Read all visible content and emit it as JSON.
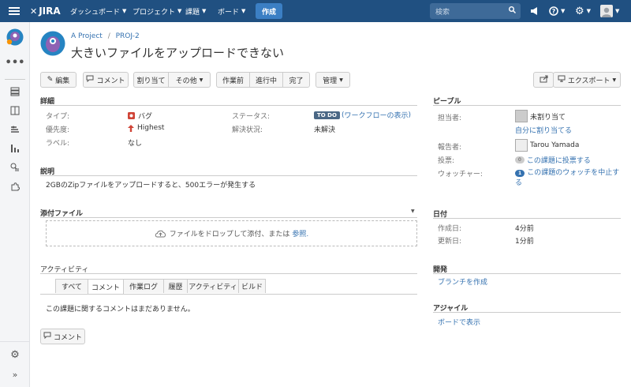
{
  "topnav": {
    "logo": "JIRA",
    "menu": [
      "ダッシュボード",
      "プロジェクト",
      "課題",
      "ボード"
    ],
    "create_label": "作成",
    "search_placeholder": "検索"
  },
  "breadcrumb": {
    "project": "A Project",
    "sep": "/",
    "issue": "PROJ-2"
  },
  "issue_title": "大きいファイルをアップロードできない",
  "toolbar": {
    "edit": "編集",
    "comment": "コメント",
    "assign": "割り当て",
    "more": "その他",
    "workflow": [
      "作業前",
      "進行中",
      "完了"
    ],
    "admin": "管理",
    "export": "エクスポート"
  },
  "details": {
    "heading": "詳細",
    "type_label": "タイプ:",
    "type_value": "バグ",
    "priority_label": "優先度:",
    "priority_value": "Highest",
    "labels_label": "ラベル:",
    "labels_value": "なし",
    "status_label": "ステータス:",
    "status_badge": "TO DO",
    "status_open": "(",
    "status_link": "ワークフローの表示",
    "status_close": ")",
    "resolution_label": "解決状況:",
    "resolution_value": "未解決"
  },
  "description": {
    "heading": "説明",
    "text": "2GBのZipファイルをアップロードすると、500エラーが発生する"
  },
  "attachments": {
    "heading": "添付ファイル",
    "drop_text": "ファイルをドロップして添付、または",
    "browse": "参照."
  },
  "activity": {
    "heading": "アクティビティ",
    "tabs": [
      "すべて",
      "コメント",
      "作業ログ",
      "履歴",
      "アクティビティ",
      "ビルド"
    ],
    "empty": "この課題に関するコメントはまだありません。",
    "comment_button": "コメント"
  },
  "people": {
    "heading": "ピープル",
    "assignee_label": "担当者:",
    "assignee_value": "未割り当て",
    "assign_me": "自分に割り当てる",
    "reporter_label": "報告者:",
    "reporter_value": "Tarou Yamada",
    "votes_label": "投票:",
    "votes_count": "0",
    "votes_link": "この課題に投票する",
    "watchers_label": "ウォッチャー:",
    "watchers_count": "1",
    "watchers_link": "この課題のウォッチを中止する"
  },
  "dates": {
    "heading": "日付",
    "created_label": "作成日:",
    "created_value": "4分前",
    "updated_label": "更新日:",
    "updated_value": "1分前"
  },
  "development": {
    "heading": "開発",
    "link": "ブランチを作成"
  },
  "agile": {
    "heading": "アジャイル",
    "link": "ボードで表示"
  },
  "colors": {
    "nav": "#205081",
    "create": "#3b7fc4",
    "link": "#3572b0",
    "todo": "#4a6785",
    "bug": "#d04437",
    "priority": "#d04437"
  },
  "icons": [
    "menu-icon",
    "jira-logo-icon",
    "search-icon",
    "megaphone-icon",
    "help-icon",
    "gear-icon",
    "user-avatar-icon",
    "project-avatar-icon",
    "more-icon",
    "backlog-icon",
    "board-icon",
    "reports-icon",
    "components-icon",
    "issues-icon",
    "addons-icon",
    "settings-icon",
    "expand-icon",
    "pencil-icon",
    "comment-icon",
    "share-icon",
    "export-icon",
    "bug-icon",
    "arrow-up-icon",
    "cloud-upload-icon"
  ]
}
